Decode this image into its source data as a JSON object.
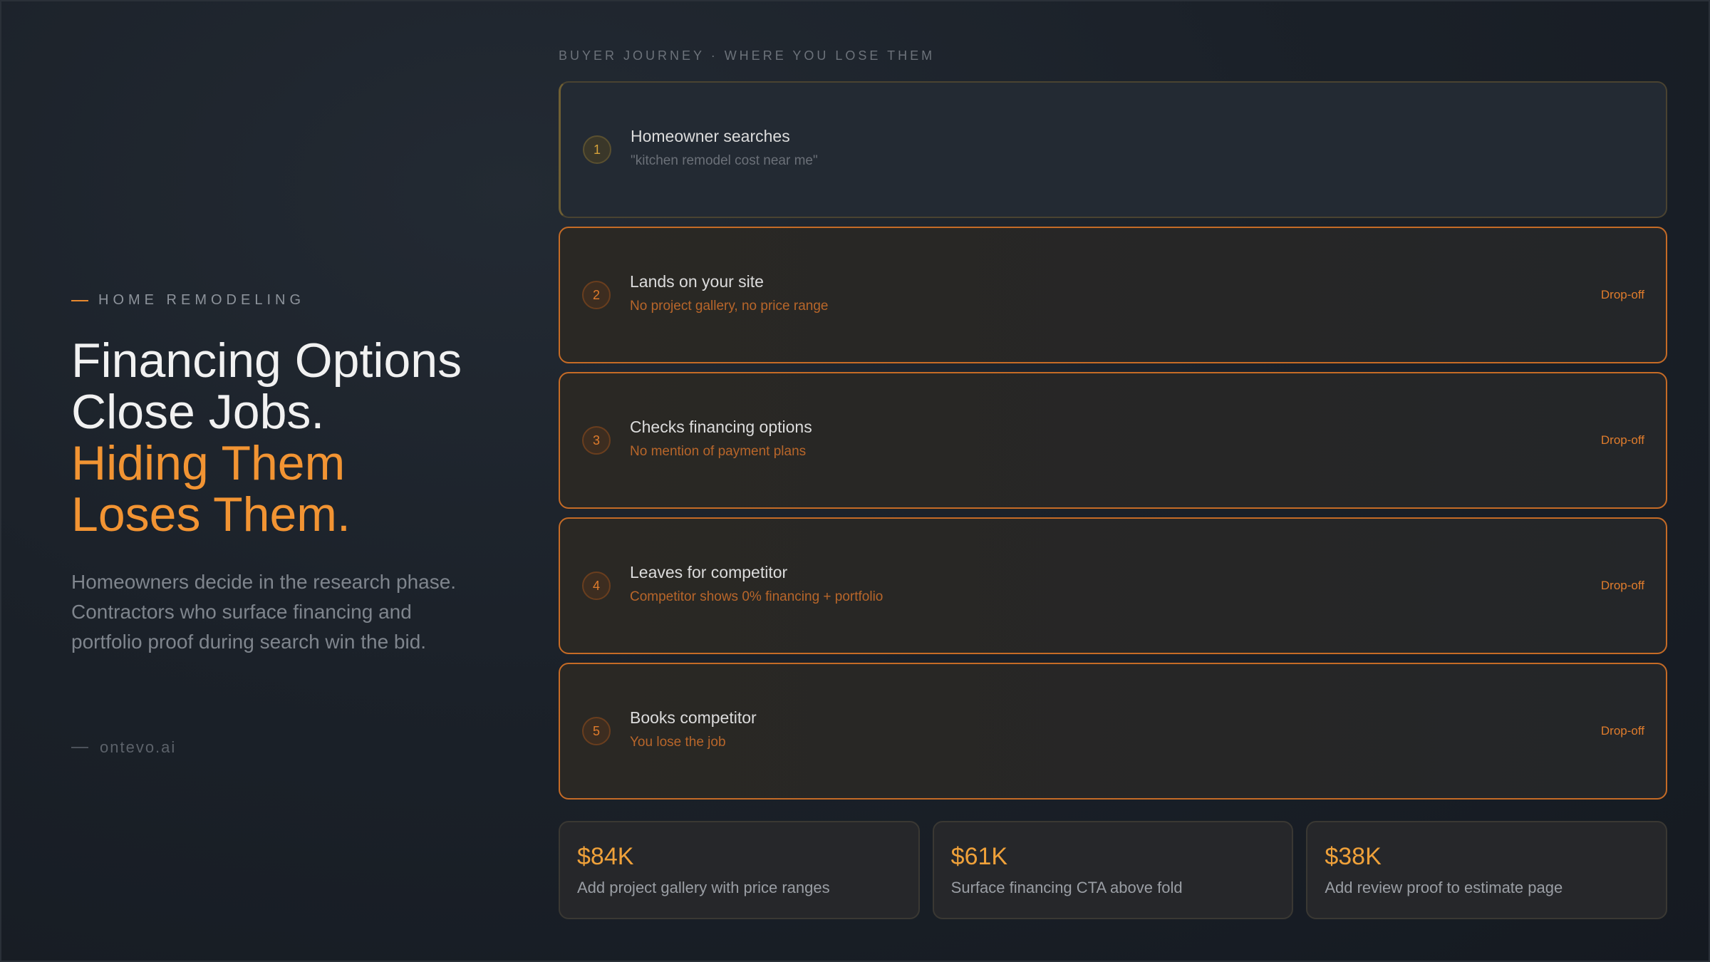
{
  "eyebrow": "HOME REMODELING",
  "headline": {
    "line1": "Financing Options",
    "line2": "Close Jobs.",
    "line3": "Hiding Them",
    "line4": "Loses Them."
  },
  "body": "Homeowners decide in the research phase. Contractors who surface financing and portfolio proof during search win the bid.",
  "brand": "ontevo.ai",
  "journey_label": "BUYER JOURNEY · WHERE YOU LOSE THEM",
  "steps": [
    {
      "num": "1",
      "title": "Homeowner searches",
      "subtitle": "\"kitchen remodel cost near me\"",
      "badge": ""
    },
    {
      "num": "2",
      "title": "Lands on your site",
      "subtitle": "No project gallery, no price range",
      "badge": "Drop-off"
    },
    {
      "num": "3",
      "title": "Checks financing options",
      "subtitle": "No mention of payment plans",
      "badge": "Drop-off"
    },
    {
      "num": "4",
      "title": "Leaves for competitor",
      "subtitle": "Competitor shows 0% financing + portfolio",
      "badge": "Drop-off"
    },
    {
      "num": "5",
      "title": "Books competitor",
      "subtitle": "You lose the job",
      "badge": "Drop-off"
    }
  ],
  "stats": [
    {
      "value": "$84K",
      "label": "Add project gallery with price ranges"
    },
    {
      "value": "$61K",
      "label": "Surface financing CTA above fold"
    },
    {
      "value": "$38K",
      "label": "Add review proof to estimate page"
    }
  ],
  "colors": {
    "accent": "#f29433",
    "dropoff": "#e07c2c",
    "background": "#1b2129"
  }
}
